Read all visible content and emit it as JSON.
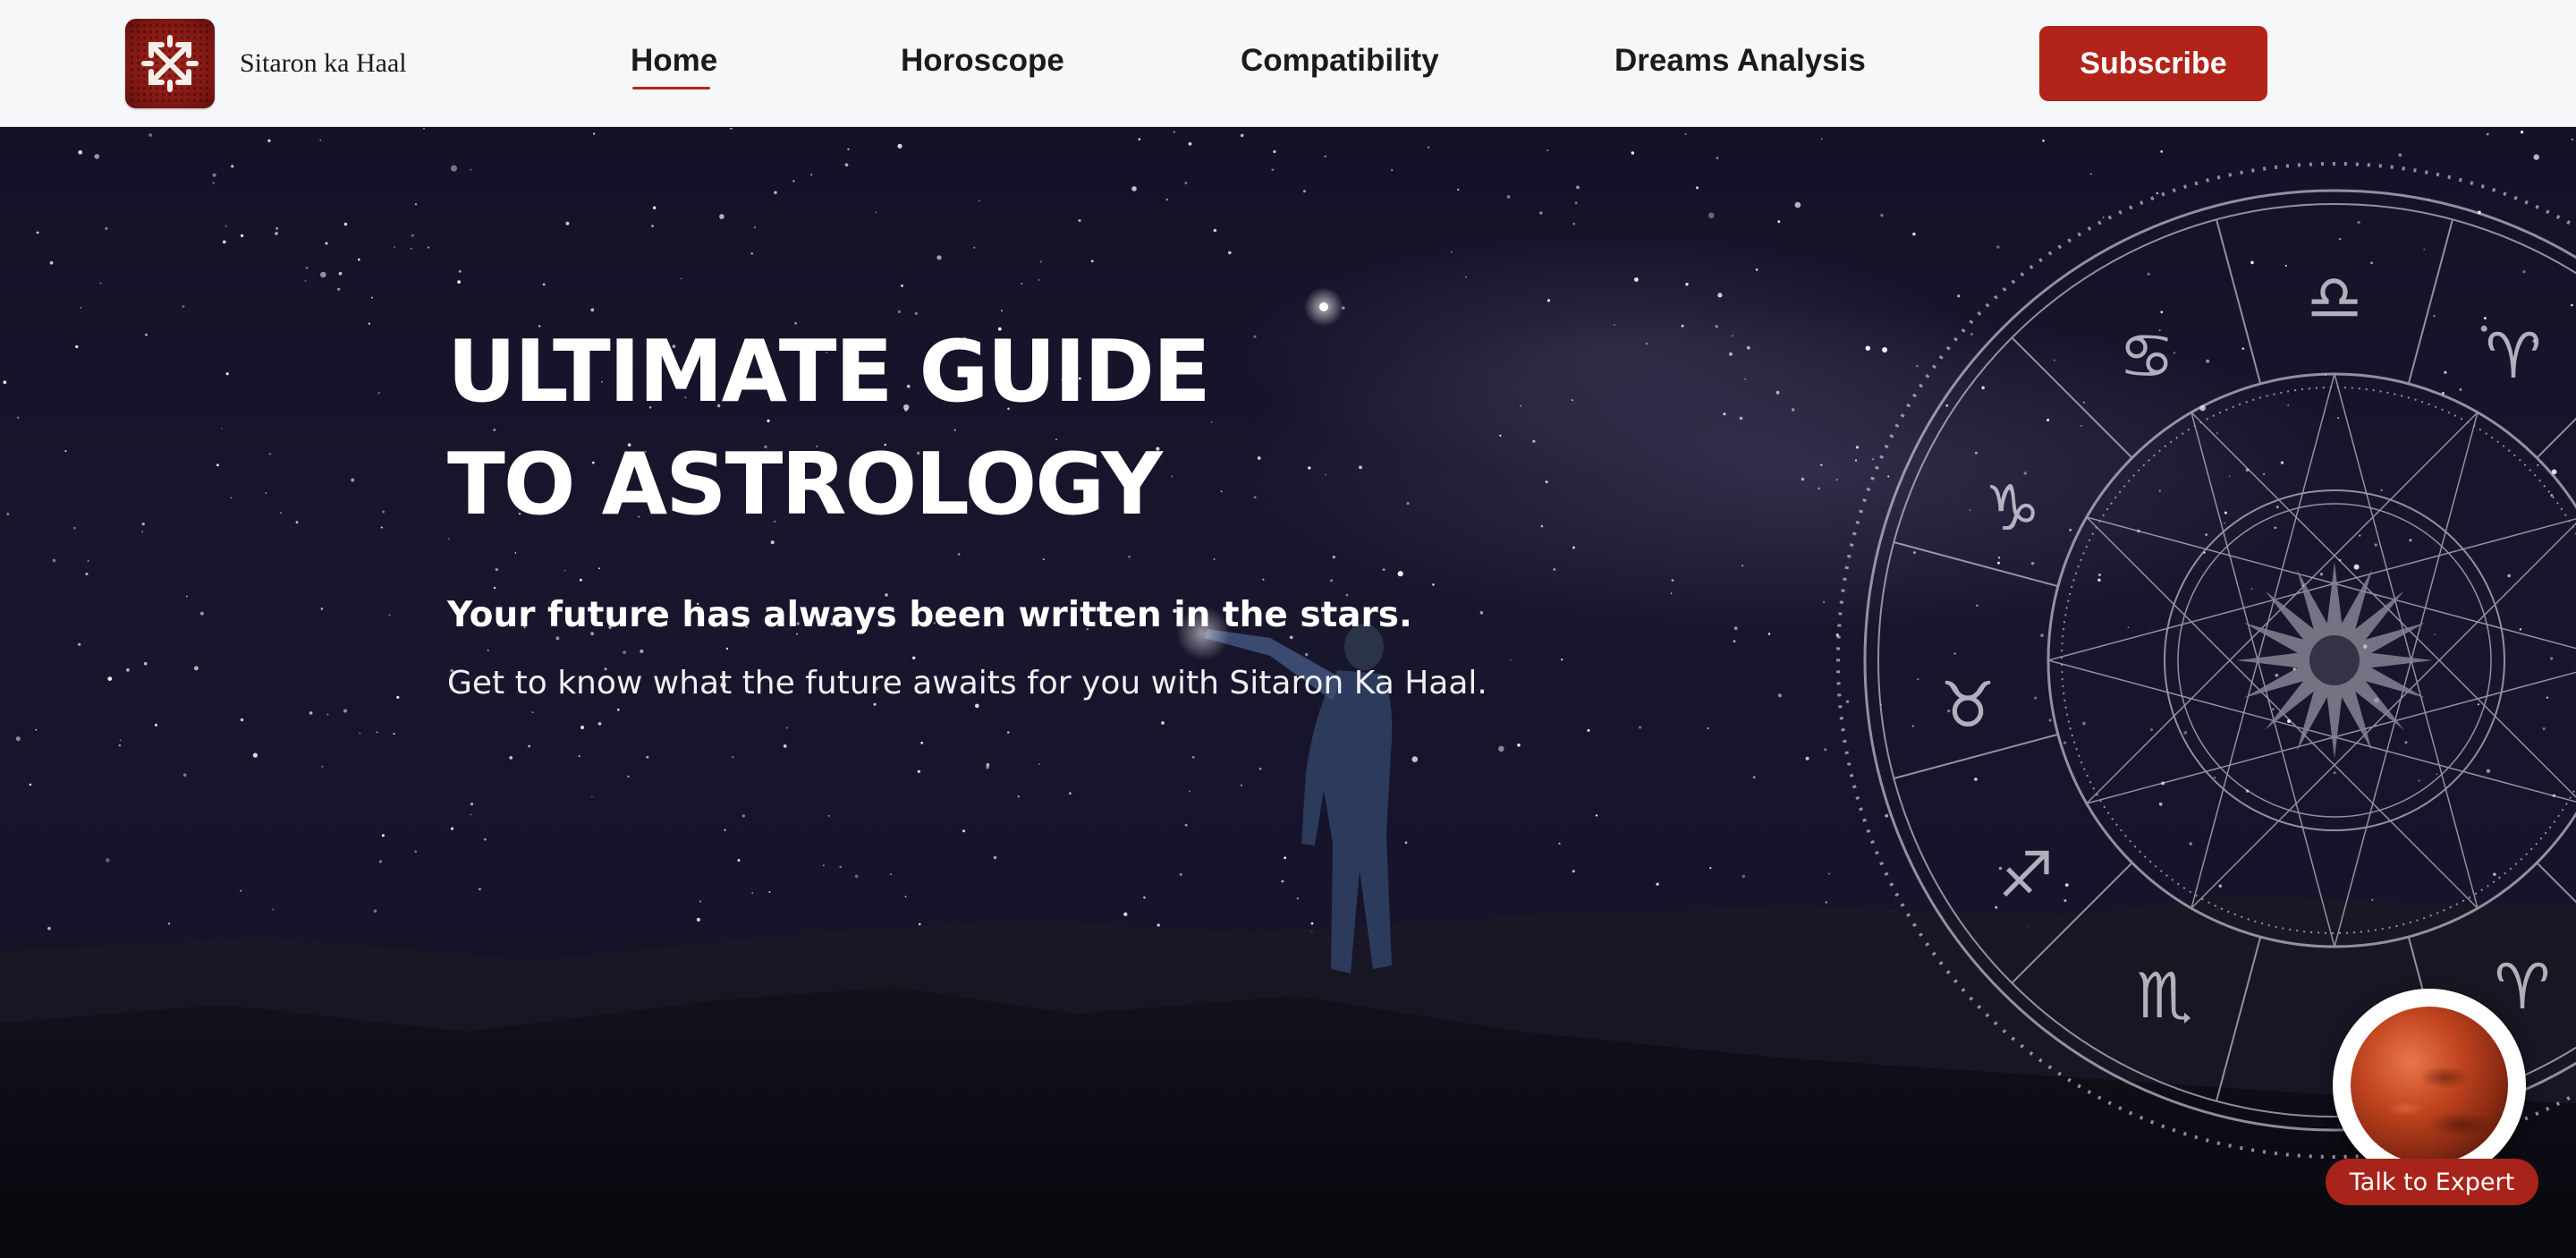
{
  "header": {
    "brand_name": "Sitaron ka Haal",
    "logo_icon": "snowflake-rune-icon",
    "nav": [
      {
        "label": "Home",
        "active": true
      },
      {
        "label": "Horoscope",
        "active": false
      },
      {
        "label": "Compatibility",
        "active": false
      },
      {
        "label": "Dreams Analysis",
        "active": false
      }
    ],
    "subscribe_label": "Subscribe"
  },
  "hero": {
    "headline_line1": "ULTIMATE GUIDE",
    "headline_line2": "TO ASTROLOGY",
    "tagline": "Your future has always been written in the stars.",
    "subline": "Get to know what the future awaits for you with Sitaron Ka Haal.",
    "zodiac_symbols": [
      "♎",
      "♋",
      "♈",
      "♑",
      "♉",
      "♐",
      "♏",
      "♈"
    ]
  },
  "widget": {
    "talk_label": "Talk to Expert",
    "image_icon": "mars-planet-icon"
  },
  "colors": {
    "accent": "#b2231a",
    "header_bg": "#f6f7f9",
    "hero_bg": "#141227"
  }
}
